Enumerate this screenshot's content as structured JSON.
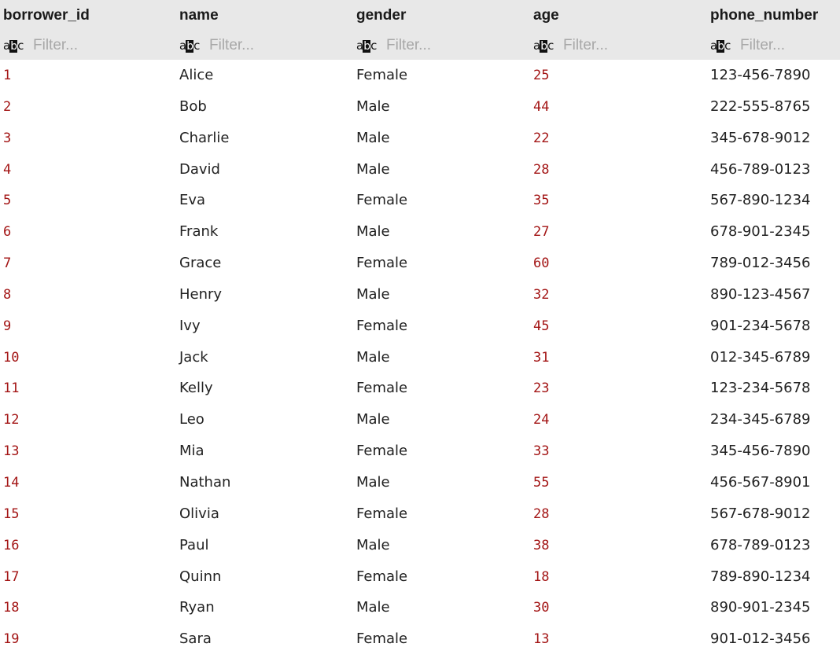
{
  "table": {
    "columns": [
      {
        "key": "borrower_id",
        "label": "borrower_id",
        "type": "numeric",
        "filter_placeholder": "Filter..."
      },
      {
        "key": "name",
        "label": "name",
        "type": "text",
        "filter_placeholder": "Filter..."
      },
      {
        "key": "gender",
        "label": "gender",
        "type": "text",
        "filter_placeholder": "Filter..."
      },
      {
        "key": "age",
        "label": "age",
        "type": "numeric",
        "filter_placeholder": "Filter..."
      },
      {
        "key": "phone_number",
        "label": "phone_number",
        "type": "text",
        "filter_placeholder": "Filter..."
      }
    ],
    "filter_icon_text": {
      "a": "a",
      "b": "b",
      "c": "c"
    },
    "rows": [
      [
        "1",
        "Alice",
        "Female",
        "25",
        "123-456-7890"
      ],
      [
        "2",
        "Bob",
        "Male",
        "44",
        "222-555-8765"
      ],
      [
        "3",
        "Charlie",
        "Male",
        "22",
        "345-678-9012"
      ],
      [
        "4",
        "David",
        "Male",
        "28",
        "456-789-0123"
      ],
      [
        "5",
        "Eva",
        "Female",
        "35",
        "567-890-1234"
      ],
      [
        "6",
        "Frank",
        "Male",
        "27",
        "678-901-2345"
      ],
      [
        "7",
        "Grace",
        "Female",
        "60",
        "789-012-3456"
      ],
      [
        "8",
        "Henry",
        "Male",
        "32",
        "890-123-4567"
      ],
      [
        "9",
        "Ivy",
        "Female",
        "45",
        "901-234-5678"
      ],
      [
        "10",
        "Jack",
        "Male",
        "31",
        "012-345-6789"
      ],
      [
        "11",
        "Kelly",
        "Female",
        "23",
        "123-234-5678"
      ],
      [
        "12",
        "Leo",
        "Male",
        "24",
        "234-345-6789"
      ],
      [
        "13",
        "Mia",
        "Female",
        "33",
        "345-456-7890"
      ],
      [
        "14",
        "Nathan",
        "Male",
        "55",
        "456-567-8901"
      ],
      [
        "15",
        "Olivia",
        "Female",
        "28",
        "567-678-9012"
      ],
      [
        "16",
        "Paul",
        "Male",
        "38",
        "678-789-0123"
      ],
      [
        "17",
        "Quinn",
        "Female",
        "18",
        "789-890-1234"
      ],
      [
        "18",
        "Ryan",
        "Male",
        "30",
        "890-901-2345"
      ],
      [
        "19",
        "Sara",
        "Female",
        "13",
        "901-012-3456"
      ]
    ]
  },
  "colors": {
    "header_bg": "#e8e8e8",
    "numeric_text": "#a31515",
    "text": "#222222",
    "placeholder": "#a8a8a8"
  }
}
